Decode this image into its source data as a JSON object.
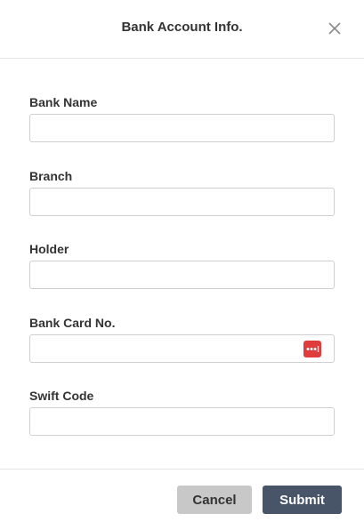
{
  "modal": {
    "title": "Bank Account Info."
  },
  "fields": {
    "bank_name": {
      "label": "Bank Name",
      "value": ""
    },
    "branch": {
      "label": "Branch",
      "value": ""
    },
    "holder": {
      "label": "Holder",
      "value": ""
    },
    "bank_card_no": {
      "label": "Bank Card No.",
      "value": "",
      "icon": "password-manager-icon"
    },
    "swift_code": {
      "label": "Swift Code",
      "value": ""
    }
  },
  "footer": {
    "cancel_label": "Cancel",
    "submit_label": "Submit"
  },
  "colors": {
    "submit_bg": "#485467",
    "cancel_bg": "#c8c8c8",
    "password_icon_bg": "#e03c3c"
  }
}
